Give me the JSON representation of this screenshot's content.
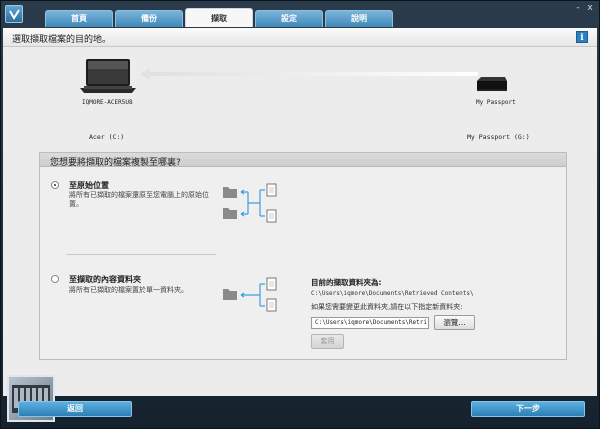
{
  "tabs": [
    {
      "label": "首頁",
      "active": false
    },
    {
      "label": "備份",
      "active": false
    },
    {
      "label": "擷取",
      "active": true
    },
    {
      "label": "設定",
      "active": false
    },
    {
      "label": "說明",
      "active": false
    }
  ],
  "window_controls": {
    "minimize": "-",
    "close": "x"
  },
  "page_title": "選取擷取檔案的目的地。",
  "info_icon_label": "i",
  "source_device": {
    "name": "IQMORE-ACER5U8",
    "icon": "laptop-icon"
  },
  "target_device": {
    "name": "My Passport",
    "icon": "hard-drive-icon"
  },
  "source_drive": "Acer (C:)",
  "target_drive": "My Passport (G:)",
  "panel": {
    "question": "您想要將擷取的檔案複製至哪裏?",
    "option_original": {
      "title": "至原始位置",
      "desc_line1": "將所有已擷取的檔案還原至您電腦上的原始位",
      "desc_line2": "置。",
      "checked": true
    },
    "option_folder": {
      "title": "至擷取的內容資料夾",
      "desc": "將所有已擷取的檔案置於單一資料夾。",
      "checked": false
    },
    "current_folder_label": "目前的擷取資料夾為:",
    "current_folder_path": "C:\\Users\\iqmore\\Documents\\Retrieved Contents\\",
    "change_hint": "如果您需要變更此資料夾,請在以下指定新資料夾:",
    "path_input_value": "C:\\Users\\iqmore\\Documents\\Retri",
    "browse_label": "瀏覽...",
    "apply_label": "套用"
  },
  "footer": {
    "back_label": "返回",
    "next_label": "下一步"
  },
  "colors": {
    "accent": "#3f88b8",
    "arrow": "#3fa0dc",
    "header_bg": "#1e2a36"
  }
}
